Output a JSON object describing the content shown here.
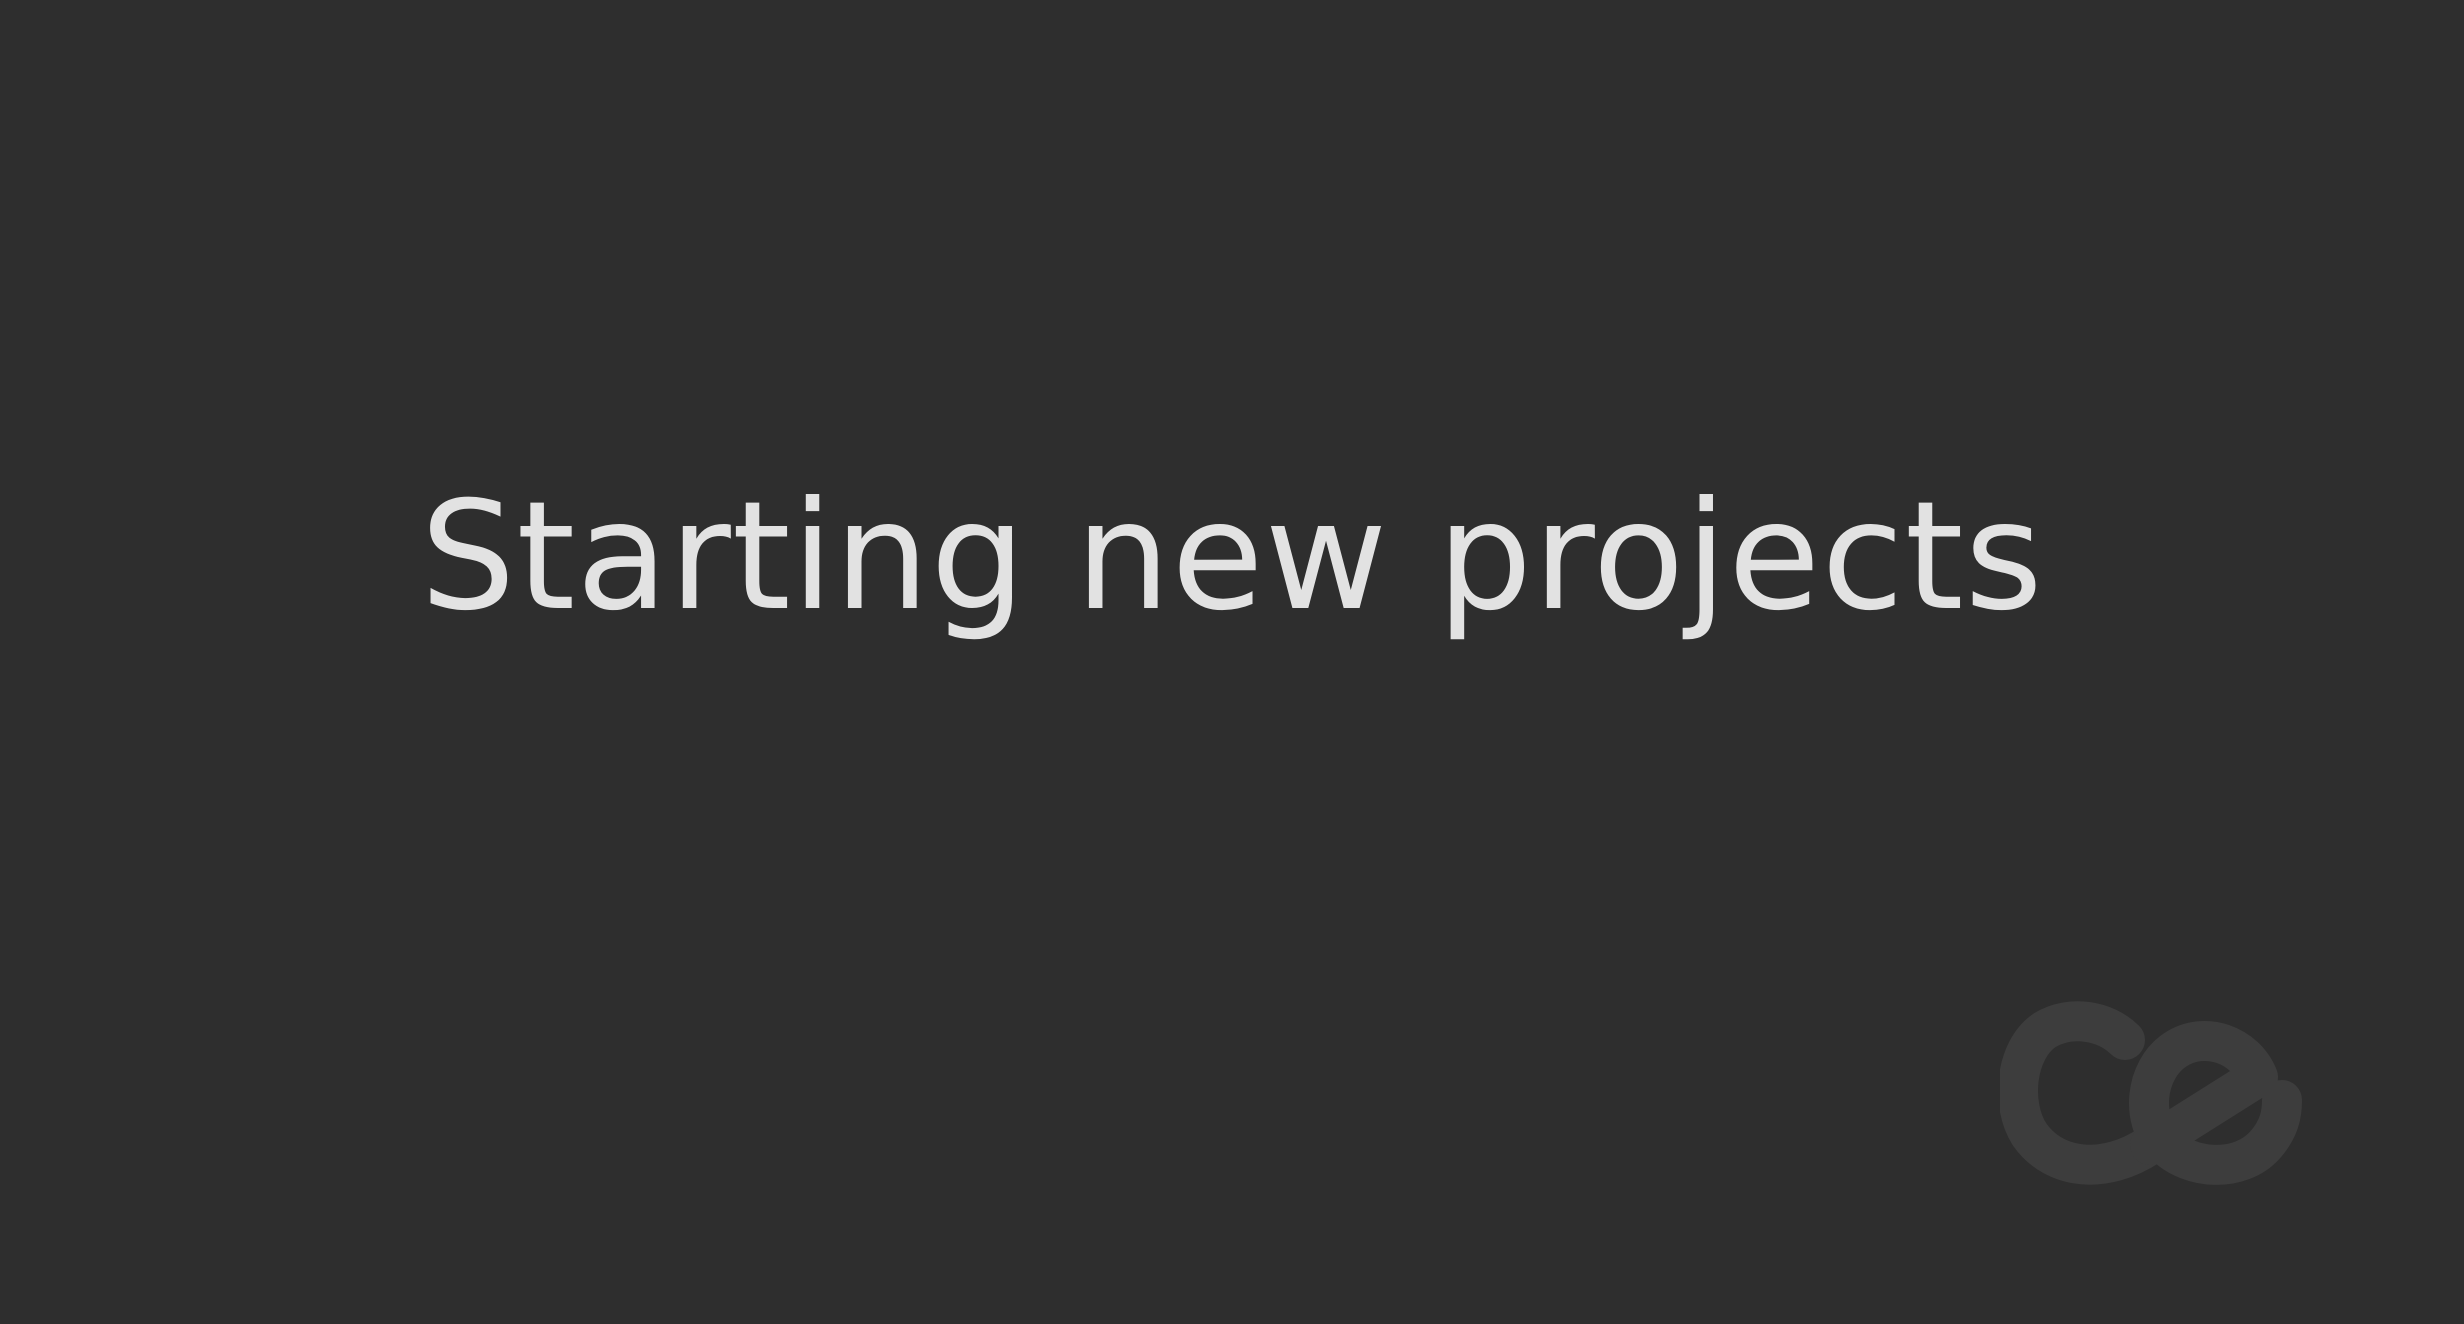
{
  "slide": {
    "title": "Starting new projects"
  },
  "logo": {
    "name": "ce-logo-icon",
    "text": "ce"
  },
  "colors": {
    "background": "#2e2e2e",
    "title_text": "#e2e2e2",
    "logo": "#3d3d3d"
  }
}
